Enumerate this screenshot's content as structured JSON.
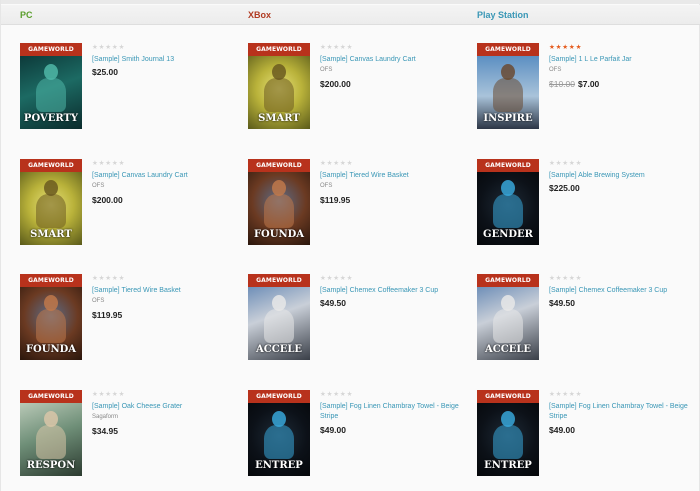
{
  "columns": [
    {
      "title": "PC",
      "color": "#5a9e2c"
    },
    {
      "title": "XBox",
      "color": "#b13b22"
    },
    {
      "title": "Play Station",
      "color": "#3a97b6"
    }
  ],
  "badge_text": "GAMEWORLD",
  "products": [
    [
      {
        "name": "[Sample] Smith Journal 13",
        "vendor": "",
        "price": "$25.00",
        "old_price": "",
        "rating": 0,
        "cover_word": "POVERTY",
        "cover_theme": "teal"
      },
      {
        "name": "[Sample] Canvas Laundry Cart",
        "vendor": "OFS",
        "price": "$200.00",
        "old_price": "",
        "rating": 0,
        "cover_word": "SMART",
        "cover_theme": "yellow"
      },
      {
        "name": "[Sample] Tiered Wire Basket",
        "vendor": "OFS",
        "price": "$119.95",
        "old_price": "",
        "rating": 0,
        "cover_word": "FOUNDA",
        "cover_theme": "copper"
      },
      {
        "name": "[Sample] Oak Cheese Grater",
        "vendor": "Sagaform",
        "price": "$34.95",
        "old_price": "",
        "rating": 0,
        "cover_word": "RESPON",
        "cover_theme": "jade"
      }
    ],
    [
      {
        "name": "[Sample] Canvas Laundry Cart",
        "vendor": "OFS",
        "price": "$200.00",
        "old_price": "",
        "rating": 0,
        "cover_word": "SMART",
        "cover_theme": "yellow"
      },
      {
        "name": "[Sample] Tiered Wire Basket",
        "vendor": "OFS",
        "price": "$119.95",
        "old_price": "",
        "rating": 0,
        "cover_word": "FOUNDA",
        "cover_theme": "copper"
      },
      {
        "name": "[Sample] Chemex Coffeemaker 3 Cup",
        "vendor": "",
        "price": "$49.50",
        "old_price": "",
        "rating": 0,
        "cover_word": "ACCELE",
        "cover_theme": "steel"
      },
      {
        "name": "[Sample] Fog Linen Chambray Towel - Beige Stripe",
        "vendor": "",
        "price": "$49.00",
        "old_price": "",
        "rating": 0,
        "cover_word": "ENTREP",
        "cover_theme": "robot"
      }
    ],
    [
      {
        "name": "[Sample] 1 L Le Parfait Jar",
        "vendor": "OFS",
        "price": "$7.00",
        "old_price": "$10.00",
        "rating": 5,
        "cover_word": "INSPIRE",
        "cover_theme": "sky"
      },
      {
        "name": "[Sample] Able Brewing System",
        "vendor": "",
        "price": "$225.00",
        "old_price": "",
        "rating": 0,
        "cover_word": "GENDER",
        "cover_theme": "robot"
      },
      {
        "name": "[Sample] Chemex Coffeemaker 3 Cup",
        "vendor": "",
        "price": "$49.50",
        "old_price": "",
        "rating": 0,
        "cover_word": "ACCELE",
        "cover_theme": "steel"
      },
      {
        "name": "[Sample] Fog Linen Chambray Towel - Beige Stripe",
        "vendor": "",
        "price": "$49.00",
        "old_price": "",
        "rating": 0,
        "cover_word": "ENTREP",
        "cover_theme": "robot"
      }
    ]
  ],
  "colors": {
    "banner": "#b8321c",
    "link": "#3a97b6",
    "star_on": "#e55a1c",
    "star_off": "#d6d6d6"
  }
}
